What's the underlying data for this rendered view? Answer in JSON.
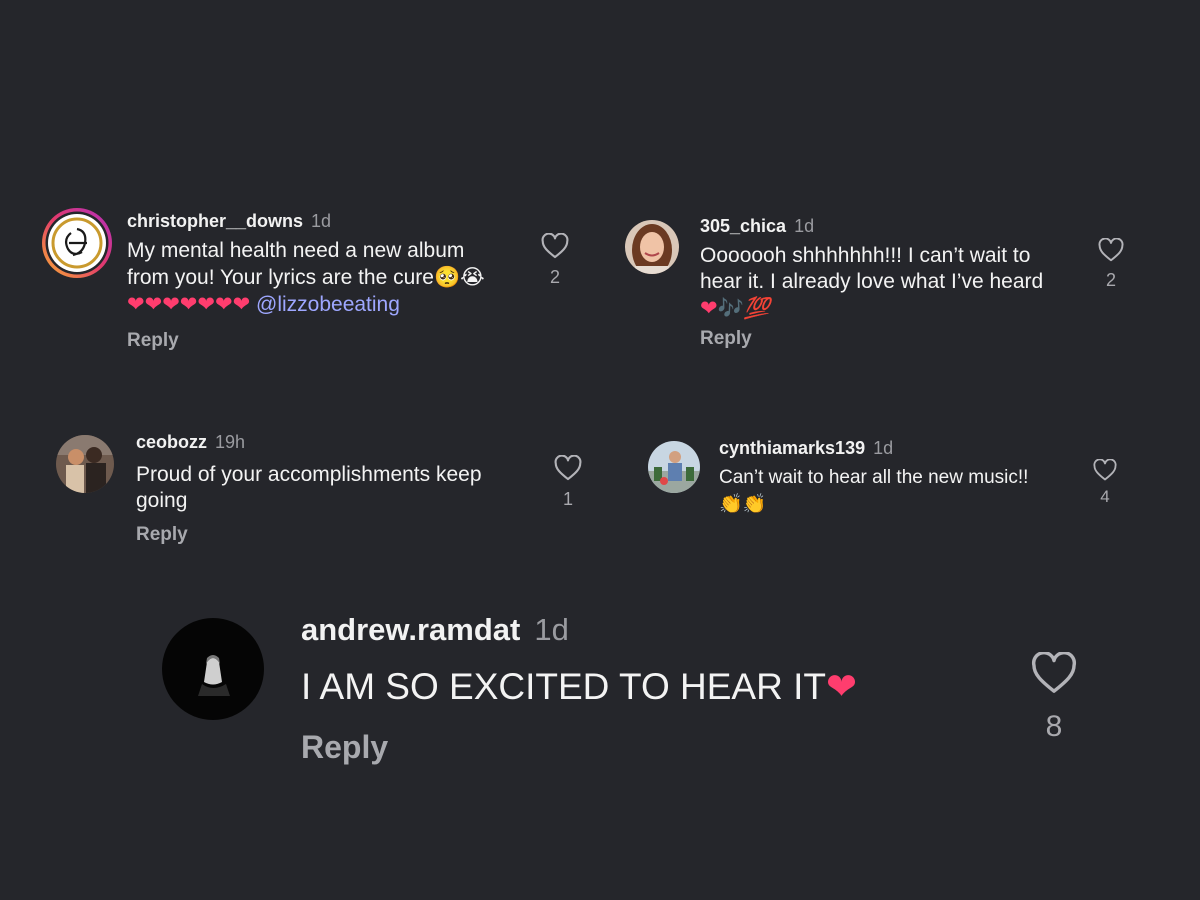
{
  "comments": [
    {
      "username": "christopher__downs",
      "time": "1d",
      "text_line1": "My mental health need a new album",
      "text_line2": "from you! Your lyrics are the cure",
      "line2_emoji": "🥺😭",
      "hearts": "❤❤❤❤❤❤❤",
      "mention": "@lizzobeeating",
      "reply_label": "Reply",
      "likes": "2",
      "avatar_icon": "gold-ring-monogram-logo"
    },
    {
      "username": "305_chica",
      "time": "1d",
      "text_line1": "Ooooooh shhhhhhh!!! I can’t wait to",
      "text_line2": "hear it. I already love what I’ve heard",
      "emoji_heart": "❤",
      "emoji_notes": "🎶",
      "emoji_hundred": "💯",
      "reply_label": "Reply",
      "likes": "2",
      "avatar_icon": "profile-photo"
    },
    {
      "username": "ceobozz",
      "time": "19h",
      "text_line1": "Proud of your accomplishments keep",
      "text_line2": "going",
      "reply_label": "Reply",
      "likes": "1",
      "avatar_icon": "profile-photo"
    },
    {
      "username": "cynthiamarks139",
      "time": "1d",
      "text_line1": "Can’t wait to hear all the new music!!",
      "claps": "👏👏",
      "likes": "4",
      "avatar_icon": "profile-photo"
    },
    {
      "username": "andrew.ramdat",
      "time": "1d",
      "text": "I AM SO EXCITED TO HEAR IT",
      "text_emoji": "❤",
      "reply_label": "Reply",
      "likes": "8",
      "avatar_icon": "profile-photo"
    }
  ],
  "colors": {
    "background": "#25262b",
    "mention": "#9ea7ff",
    "heart_emoji": "#ff3d6e",
    "muted_text": "#9a9ba0"
  },
  "icons": {
    "like": "heart-outline-icon"
  }
}
